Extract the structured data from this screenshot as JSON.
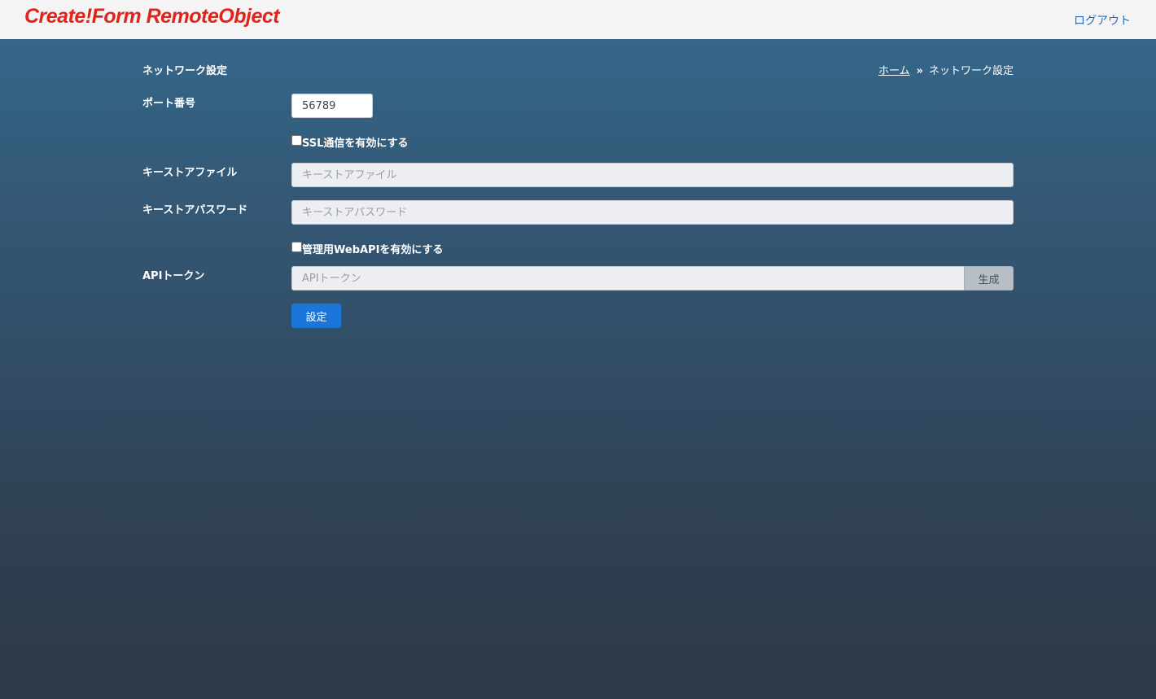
{
  "header": {
    "brand": "Create!Form RemoteObject",
    "logout_label": "ログアウト"
  },
  "page": {
    "title": "ネットワーク設定",
    "breadcrumb": {
      "home": "ホーム",
      "separator": "»",
      "current": "ネットワーク設定"
    }
  },
  "form": {
    "port": {
      "label": "ポート番号",
      "value": "56789"
    },
    "ssl_checkbox": {
      "label": "SSL通信を有効にする",
      "checked": false
    },
    "keystore_file": {
      "label": "キーストアファイル",
      "placeholder": "キーストアファイル"
    },
    "keystore_password": {
      "label": "キーストアパスワード",
      "placeholder": "キーストアパスワード"
    },
    "webapi_checkbox": {
      "label": "管理用WebAPIを有効にする",
      "checked": false
    },
    "api_token": {
      "label": "APIトークン",
      "placeholder": "APIトークン",
      "generate_label": "生成"
    },
    "submit_label": "設定"
  },
  "colors": {
    "brand": "#e0241b",
    "link": "#1f6dc8",
    "primary_button": "#1c75d8",
    "background_top": "#356a8f",
    "background_bottom": "#2e3a47"
  }
}
